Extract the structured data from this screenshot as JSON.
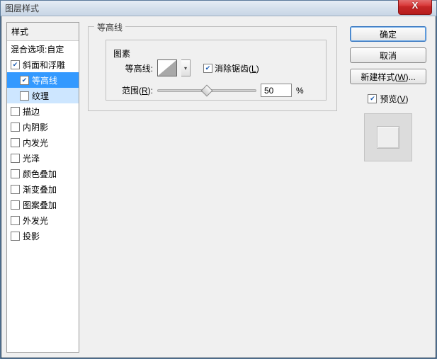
{
  "window": {
    "title": "图层样式"
  },
  "close": {
    "glyph": "X"
  },
  "sidebar": {
    "header": "样式",
    "items": [
      {
        "label": "混合选项:自定",
        "checkbox": false,
        "checked": false,
        "selected": false,
        "indent": 1
      },
      {
        "label": "斜面和浮雕",
        "checkbox": true,
        "checked": true,
        "selected": false,
        "indent": 1
      },
      {
        "label": "等高线",
        "checkbox": true,
        "checked": true,
        "selected": true,
        "indent": 2
      },
      {
        "label": "纹理",
        "checkbox": true,
        "checked": false,
        "selected": false,
        "sub": true,
        "indent": 2
      },
      {
        "label": "描边",
        "checkbox": true,
        "checked": false,
        "selected": false,
        "indent": 1
      },
      {
        "label": "内阴影",
        "checkbox": true,
        "checked": false,
        "selected": false,
        "indent": 1
      },
      {
        "label": "内发光",
        "checkbox": true,
        "checked": false,
        "selected": false,
        "indent": 1
      },
      {
        "label": "光泽",
        "checkbox": true,
        "checked": false,
        "selected": false,
        "indent": 1
      },
      {
        "label": "颜色叠加",
        "checkbox": true,
        "checked": false,
        "selected": false,
        "indent": 1
      },
      {
        "label": "渐变叠加",
        "checkbox": true,
        "checked": false,
        "selected": false,
        "indent": 1
      },
      {
        "label": "图案叠加",
        "checkbox": true,
        "checked": false,
        "selected": false,
        "indent": 1
      },
      {
        "label": "外发光",
        "checkbox": true,
        "checked": false,
        "selected": false,
        "indent": 1
      },
      {
        "label": "投影",
        "checkbox": true,
        "checked": false,
        "selected": false,
        "indent": 1
      }
    ]
  },
  "panel": {
    "outer_legend": "等高线",
    "inner_legend": "图素",
    "contour_label": "等高线:",
    "antialias_label": "消除锯齿(L)",
    "antialias_checked": true,
    "range_label": "范围(R):",
    "range_value": "50",
    "range_unit": "%",
    "slider_percent": 50
  },
  "buttons": {
    "ok": "确定",
    "cancel": "取消",
    "newstyle": "新建样式(W)..."
  },
  "preview": {
    "label": "预览(V)",
    "checked": true
  }
}
